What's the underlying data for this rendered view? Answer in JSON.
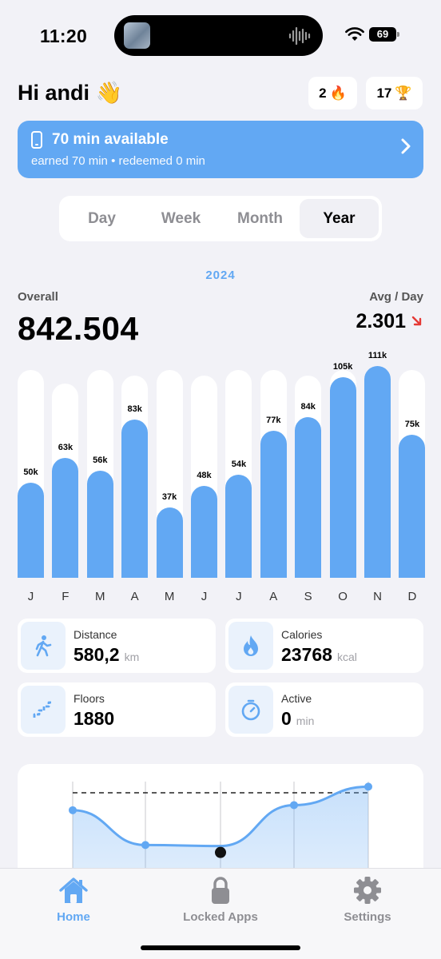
{
  "status": {
    "time": "11:20",
    "battery": "69"
  },
  "header": {
    "greeting": "Hi andi",
    "wave_emoji": "👋",
    "streak_count": "2",
    "streak_emoji": "🔥",
    "trophy_count": "17",
    "trophy_emoji": "🏆"
  },
  "banner": {
    "title": "70 min available",
    "subtitle": "earned 70 min • redeemed 0 min",
    "color": "#62a8f3"
  },
  "period_tabs": [
    {
      "label": "Day",
      "active": false
    },
    {
      "label": "Week",
      "active": false
    },
    {
      "label": "Month",
      "active": false
    },
    {
      "label": "Year",
      "active": true
    }
  ],
  "summary": {
    "year": "2024",
    "overall_label": "Overall",
    "overall_value": "842.504",
    "avg_label": "Avg / Day",
    "avg_value": "2.301",
    "avg_trend": "down",
    "trend_color": "#e53935"
  },
  "chart_data": {
    "type": "bar",
    "categories": [
      "J",
      "F",
      "M",
      "A",
      "M",
      "J",
      "J",
      "A",
      "S",
      "O",
      "N",
      "D"
    ],
    "values": [
      50000,
      63000,
      56000,
      83000,
      37000,
      48000,
      54000,
      77000,
      84000,
      105000,
      111000,
      75000
    ],
    "data_labels": [
      "50k",
      "63k",
      "56k",
      "83k",
      "37k",
      "48k",
      "54k",
      "77k",
      "84k",
      "105k",
      "111k",
      "75k"
    ],
    "bar_color": "#62a8f3"
  },
  "stats": [
    {
      "title": "Distance",
      "value": "580,2",
      "unit": "km",
      "icon": "walking-person-icon"
    },
    {
      "title": "Calories",
      "value": "23768",
      "unit": "kcal",
      "icon": "flame-icon"
    },
    {
      "title": "Floors",
      "value": "1880",
      "unit": "",
      "icon": "stairs-icon"
    },
    {
      "title": "Active",
      "value": "0",
      "unit": "min",
      "icon": "stopwatch-icon"
    }
  ],
  "trend_chart": {
    "type": "area",
    "relative_values": [
      0.72,
      0.38,
      0.37,
      0.77,
      0.95
    ],
    "target_line": true,
    "color": "#62a8f3"
  },
  "tabbar": [
    {
      "label": "Home",
      "icon": "house-icon",
      "active": true
    },
    {
      "label": "Locked Apps",
      "icon": "lock-icon",
      "active": false
    },
    {
      "label": "Settings",
      "icon": "gear-icon",
      "active": false
    }
  ]
}
